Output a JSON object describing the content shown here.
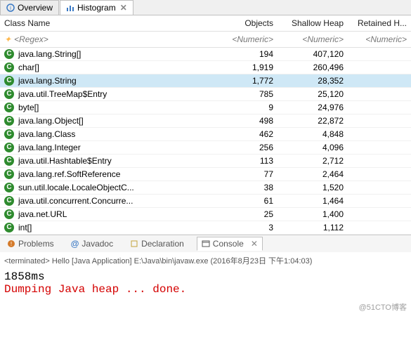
{
  "top_tabs": {
    "overview": "Overview",
    "histogram": "Histogram",
    "close_glyph": "✕"
  },
  "table": {
    "headers": {
      "name": "Class Name",
      "objects": "Objects",
      "shallow": "Shallow Heap",
      "retained": "Retained H..."
    },
    "filter": {
      "regex": "<Regex>",
      "numeric": "<Numeric>"
    },
    "icon_char": "C",
    "rows": [
      {
        "name": "java.lang.String[]",
        "objects": "194",
        "shallow": "407,120",
        "sel": false
      },
      {
        "name": "char[]",
        "objects": "1,919",
        "shallow": "260,496",
        "sel": false
      },
      {
        "name": "java.lang.String",
        "objects": "1,772",
        "shallow": "28,352",
        "sel": true
      },
      {
        "name": "java.util.TreeMap$Entry",
        "objects": "785",
        "shallow": "25,120",
        "sel": false
      },
      {
        "name": "byte[]",
        "objects": "9",
        "shallow": "24,976",
        "sel": false
      },
      {
        "name": "java.lang.Object[]",
        "objects": "498",
        "shallow": "22,872",
        "sel": false
      },
      {
        "name": "java.lang.Class",
        "objects": "462",
        "shallow": "4,848",
        "sel": false
      },
      {
        "name": "java.lang.Integer",
        "objects": "256",
        "shallow": "4,096",
        "sel": false
      },
      {
        "name": "java.util.Hashtable$Entry",
        "objects": "113",
        "shallow": "2,712",
        "sel": false
      },
      {
        "name": "java.lang.ref.SoftReference",
        "objects": "77",
        "shallow": "2,464",
        "sel": false
      },
      {
        "name": "sun.util.locale.LocaleObjectC...",
        "objects": "38",
        "shallow": "1,520",
        "sel": false
      },
      {
        "name": "java.util.concurrent.Concurre...",
        "objects": "61",
        "shallow": "1,464",
        "sel": false
      },
      {
        "name": "java.net.URL",
        "objects": "25",
        "shallow": "1,400",
        "sel": false
      },
      {
        "name": "int[]",
        "objects": "3",
        "shallow": "1,112",
        "sel": false
      }
    ]
  },
  "bottom_tabs": {
    "problems": "Problems",
    "javadoc": "Javadoc",
    "declaration": "Declaration",
    "console": "Console",
    "close_glyph": "✕"
  },
  "console": {
    "meta": "<terminated> Hello [Java Application] E:\\Java\\bin\\javaw.exe (2016年8月23日 下午1:04:03)",
    "line1": "1858ms",
    "line2": "Dumping Java heap ... done."
  },
  "watermark": "@51CTO博客"
}
